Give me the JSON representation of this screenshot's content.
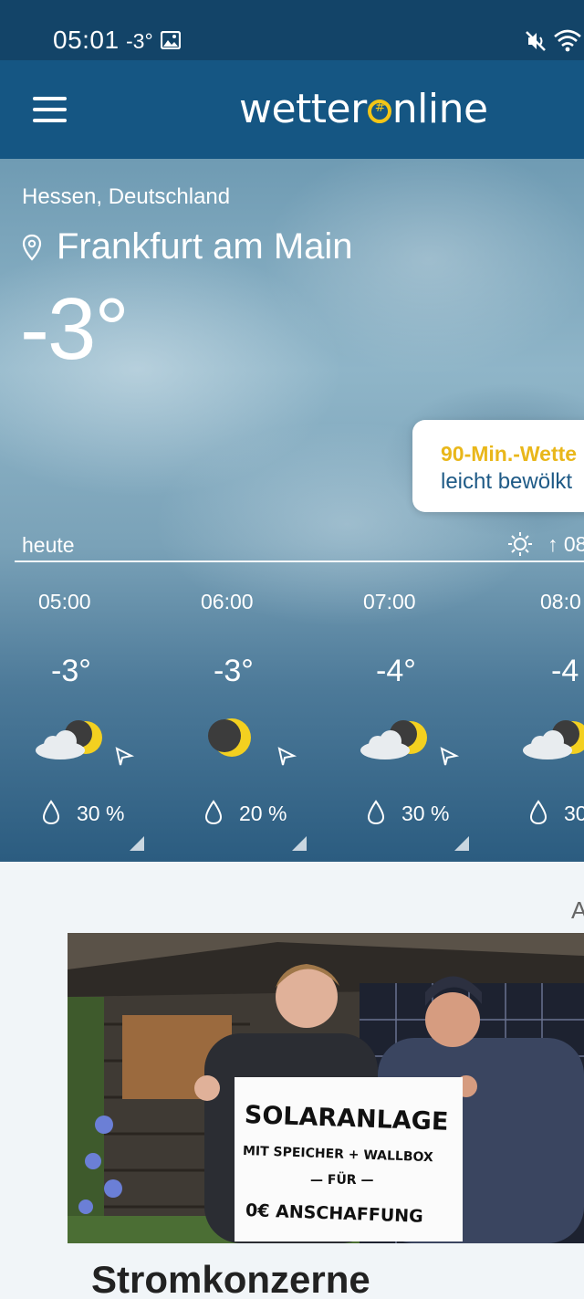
{
  "status_bar": {
    "time": "05:01",
    "temp": "-3°"
  },
  "header": {
    "logo_prefix": "wetter",
    "logo_suffix": "nline",
    "accent_color": "#f3c516"
  },
  "current": {
    "region": "Hessen, Deutschland",
    "city": "Frankfurt am Main",
    "temperature": "-3°"
  },
  "nowcast": {
    "title": "90-Min.-Wette",
    "description": "leicht bewölkt"
  },
  "day": {
    "label": "heute",
    "sunrise": "↑ 08"
  },
  "hourly": [
    {
      "time": "05:00",
      "temp": "-3°",
      "icon": "cloud-moon-icon",
      "precip": "30 %"
    },
    {
      "time": "06:00",
      "temp": "-3°",
      "icon": "moon-icon",
      "precip": "20 %"
    },
    {
      "time": "07:00",
      "temp": "-4°",
      "icon": "cloud-moon-icon",
      "precip": "30 %"
    },
    {
      "time": "08:0",
      "temp": "-4",
      "icon": "cloud-moon-icon",
      "precip": "30"
    }
  ],
  "news": {
    "section_initial": "A",
    "headline": "Stromkonzerne",
    "sign_lines": [
      "SOLARANLAGE",
      "MIT SPEICHER + WALLBOX",
      "— FÜR —",
      "0€ ANSCHAFFUNG"
    ]
  }
}
